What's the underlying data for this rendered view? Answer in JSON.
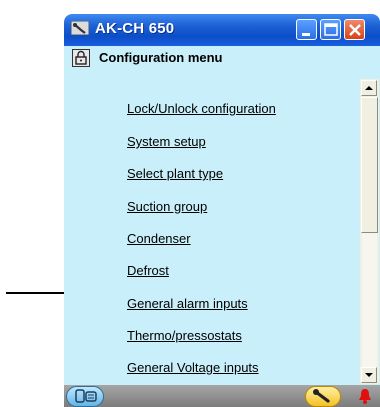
{
  "window": {
    "title": "AK-CH 650"
  },
  "menu": {
    "header": "Configuration menu",
    "items": [
      "Lock/Unlock configuration",
      "System setup",
      "Select plant type",
      "Suction group",
      "Condenser",
      "Defrost",
      "General alarm inputs",
      "Thermo/pressostats",
      "General Voltage inputs"
    ]
  },
  "icons": {
    "app": "wrench-icon",
    "minimize": "minimize-icon",
    "maximize": "maximize-icon",
    "close": "close-icon",
    "header": "lock-icon",
    "bottom_left": "controller-icon",
    "bottom_middle": "wrench-icon",
    "bottom_right": "bell-icon",
    "annotation": "arrow-right-icon"
  },
  "colors": {
    "titlebar": "#0b4ec7",
    "content_bg": "#c9f0fa",
    "close_button": "#d5421a",
    "bottombar": "#8a8a8a",
    "bell": "#e01010"
  }
}
